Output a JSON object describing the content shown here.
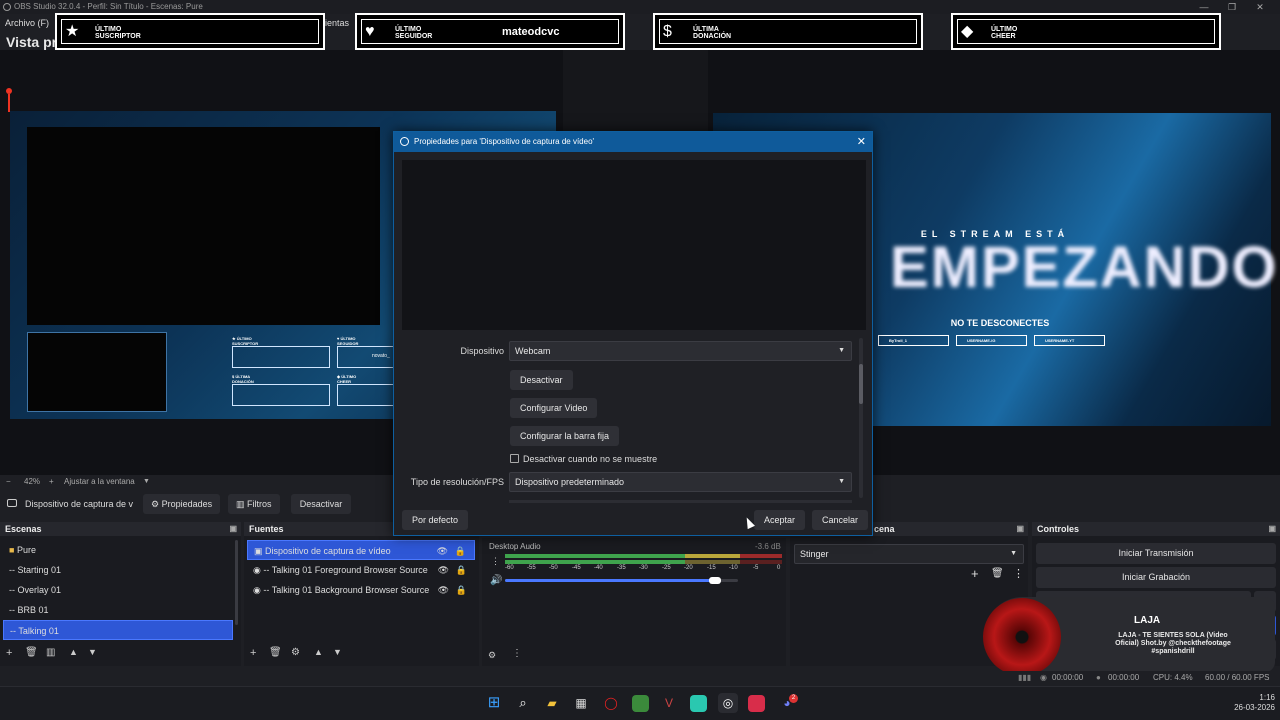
{
  "window": {
    "title": "OBS Studio 32.0.4 - Perfil: Sin Título - Escenas: Pure",
    "minimize": "—",
    "maximize": "❐",
    "close": "✕"
  },
  "menu": {
    "archivo": "Archivo (F)",
    "herramientas_partial": "ientas"
  },
  "vista_title": "Vista pr",
  "banners": [
    {
      "icon": "star-icon",
      "glyph": "★",
      "label_line1": "ÚLTIMO",
      "label_line2": "SUSCRIPTOR",
      "value": ""
    },
    {
      "icon": "heart-icon",
      "glyph": "♥",
      "label_line1": "ÚLTIMO",
      "label_line2": "SEGUIDOR",
      "value": "mateodcvc"
    },
    {
      "icon": "dollar-icon",
      "glyph": "$",
      "label_line1": "ÚLTIMA",
      "label_line2": "DONACIÓN",
      "value": ""
    },
    {
      "icon": "diamond-icon",
      "glyph": "◆",
      "label_line1": "ÚLTIMO",
      "label_line2": "CHEER",
      "value": ""
    }
  ],
  "left_preview": {
    "mini_labels": [
      {
        "line1": "ÚLTIMO",
        "line2": "SUSCRIPTOR",
        "glyph": "★"
      },
      {
        "line1": "ÚLTIMO",
        "line2": "SEGUIDOR",
        "glyph": "♥",
        "value": "novato_"
      },
      {
        "line1": "ÚLTIMA",
        "line2": "DONACIÓN",
        "glyph": "$"
      },
      {
        "line1": "ÚLTIMO",
        "line2": "CHEER",
        "glyph": "◆"
      }
    ]
  },
  "right_preview": {
    "kicker": "EL STREAM ESTÁ",
    "headline": "EMPEZANDO",
    "subline": "NO TE DESCONECTES",
    "socials": [
      "ByTroll_1",
      "USERNAME-IG",
      "USERNAME-YT"
    ]
  },
  "zoom": {
    "minus": "−",
    "level": "42%",
    "plus": "+",
    "fit": "Ajustar a la ventana"
  },
  "source_toolbar": {
    "source_name": "Dispositivo de captura de v",
    "properties": "Propiedades",
    "filters": "Filtros",
    "deactivate": "Desactivar"
  },
  "dialog": {
    "title": "Propiedades para 'Dispositivo de captura de vídeo'",
    "device_label": "Dispositivo",
    "device_value": "Webcam",
    "btn_deactivate": "Desactivar",
    "btn_config_video": "Configurar Video",
    "btn_config_bar": "Configurar la barra fija",
    "checkbox_label": "Desactivar cuando no se muestre",
    "res_label": "Tipo de resolución/FPS",
    "res_value": "Dispositivo predeterminado",
    "btn_defaults": "Por defecto",
    "btn_ok": "Aceptar",
    "btn_cancel": "Cancelar"
  },
  "scenes": {
    "title": "Escenas",
    "items": [
      "Pure",
      "-- Starting 01",
      "-- Overlay 01",
      "-- BRB 01",
      "-- Talking 01"
    ],
    "selected_index": 4
  },
  "sources": {
    "title": "Fuentes",
    "items": [
      "Dispositivo de captura de vídeo",
      "-- Talking 01  Foreground Browser Source",
      "-- Talking 01  Background Browser Source"
    ],
    "selected_index": 0
  },
  "mixer": {
    "track": "Desktop Audio",
    "db": "-3.6 dB",
    "ticks": [
      "-60",
      "-55",
      "-50",
      "-45",
      "-40",
      "-35",
      "-30",
      "-25",
      "-20",
      "-15",
      "-10",
      "-5",
      "0"
    ],
    "volume_fraction": 0.9
  },
  "transitions": {
    "title_partial": "cena",
    "value": "Stinger"
  },
  "controls": {
    "title": "Controles",
    "start_stream": "Iniciar Transmisión",
    "start_record": "Iniciar Grabación",
    "start_vcam": "Iniciar Cámara Virtual"
  },
  "music": {
    "title": "LAJA",
    "line1": "LAJA - TE SIENTES SOLA (Video",
    "line2": "Oficial) Shot.by @checkthefootage",
    "line3": "#spanishdrill"
  },
  "status": {
    "stream_time": "00:00:00",
    "rec_time": "00:00:00",
    "cpu": "CPU: 4.4%",
    "fps": "60.00 / 60.00 FPS"
  },
  "clock": {
    "time": "1:16",
    "date": "26-03-2026"
  },
  "taskbar": {
    "discord_badge": "2"
  },
  "colors": {
    "accent_blue": "#2e57d6",
    "dialog_title": "#0f5a9a",
    "meter_green": "#3fa34d",
    "meter_yellow": "#b9a63a",
    "meter_red": "#9b2a2a"
  }
}
